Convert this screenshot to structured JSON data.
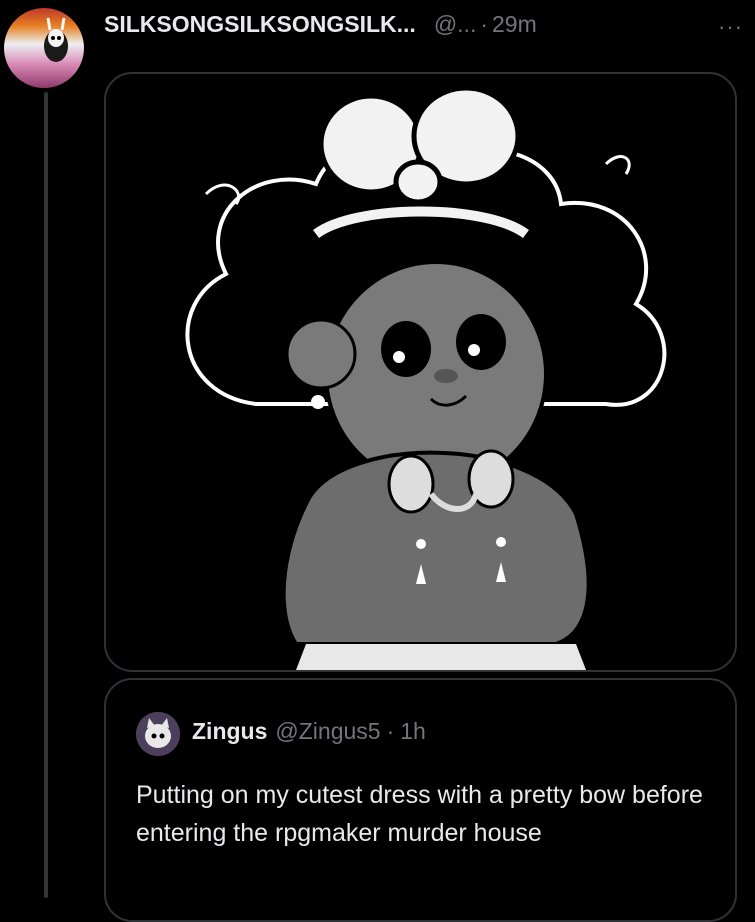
{
  "tweet": {
    "display_name": "SILKSONGSILKSONGSILK...",
    "handle": "@...",
    "separator": "·",
    "time": "29m",
    "more": "···",
    "avatar_icon": "pride-flag-hornet-avatar-icon",
    "media_icon": "cartoon-girl-bow-illustration"
  },
  "quote": {
    "display_name": "Zingus",
    "handle": "@Zingus5",
    "separator": "·",
    "time": "1h",
    "text": "Putting on my cutest dress with a pretty bow before entering the rpgmaker murder house",
    "avatar_icon": "cat-mask-avatar-icon"
  },
  "colors": {
    "background": "#000000",
    "primary_text": "#e7e9ea",
    "secondary_text": "#71767b",
    "border": "#2f3336"
  }
}
